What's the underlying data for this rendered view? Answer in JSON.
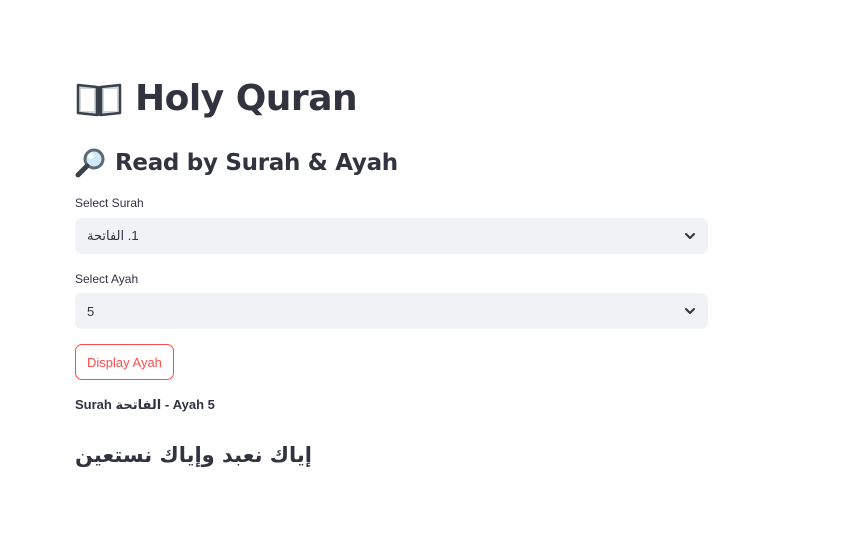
{
  "header": {
    "icon": "open-book-icon",
    "title": "Holy Quran"
  },
  "section": {
    "icon": "magnifier-icon",
    "title": "Read by Surah & Ayah"
  },
  "surah_select": {
    "label": "Select Surah",
    "value": "1. الفاتحة"
  },
  "ayah_select": {
    "label": "Select Ayah",
    "value": "5"
  },
  "display_button": {
    "label": "Display Ayah"
  },
  "result": {
    "reference_prefix": "Surah",
    "surah_name": "الفاتحة",
    "reference_suffix": "- Ayah 5",
    "ayah_text": "إياك نعبد وإياك نستعين"
  },
  "colors": {
    "accent": "#ff4b4b",
    "text": "#31333f",
    "input_bg": "#f0f2f6"
  }
}
